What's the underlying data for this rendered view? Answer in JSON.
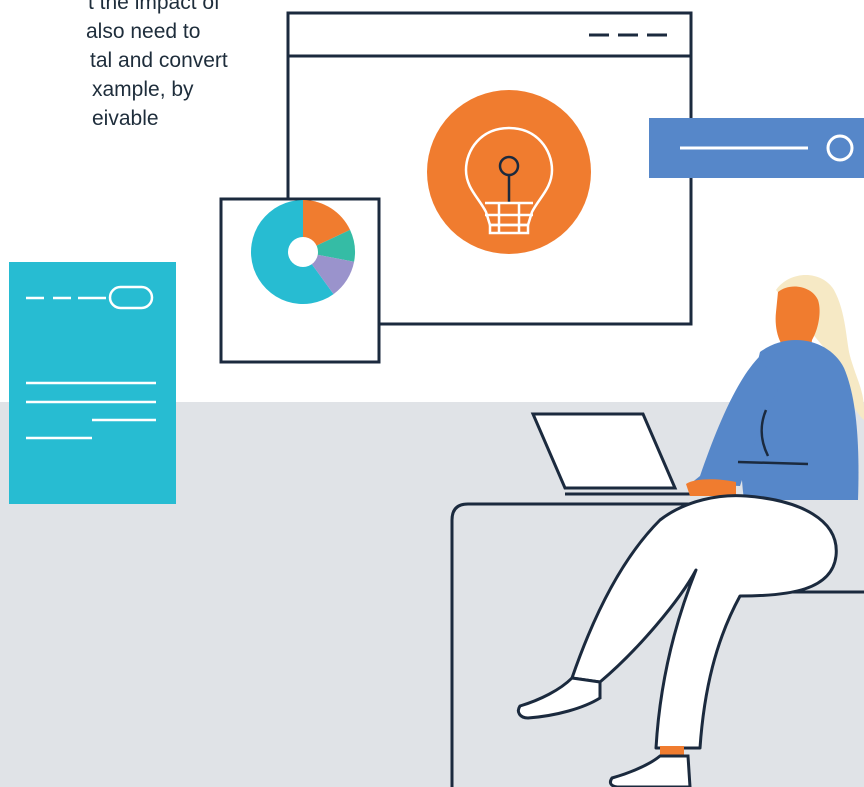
{
  "text_fragment": {
    "lines": [
      "t the impact of",
      "also need to",
      "tal and convert",
      "xample, by",
      "eivable"
    ]
  },
  "colors": {
    "navy": "#1b2a3e",
    "orange": "#f07c2f",
    "teal": "#27bcd2",
    "blue": "#5687c9",
    "purple": "#9a93cc",
    "green": "#35bca5",
    "floor": "#e0e3e7",
    "hair": "#f6e9c5",
    "skin": "#f07c2f"
  },
  "icons": {
    "bulb": "lightbulb-icon",
    "pie": "pie-chart-icon",
    "slider": "slider-icon",
    "document": "document-icon"
  },
  "pie": {
    "slices": [
      {
        "name": "teal",
        "fraction": 0.6
      },
      {
        "name": "orange",
        "fraction": 0.18
      },
      {
        "name": "green",
        "fraction": 0.1
      },
      {
        "name": "purple",
        "fraction": 0.12
      }
    ]
  }
}
